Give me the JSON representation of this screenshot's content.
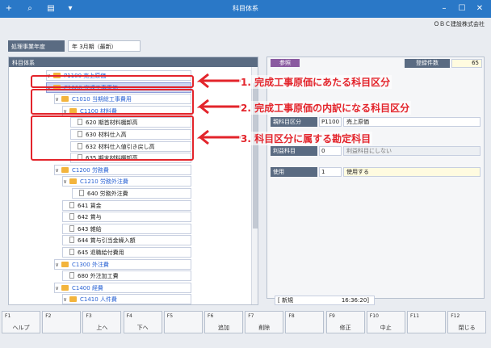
{
  "window": {
    "title": "科目体系"
  },
  "company": "ＯＢＣ建設株式会社",
  "biz_year": {
    "label": "処理事業年度",
    "value": "年 3月期（最新）"
  },
  "left_panel": {
    "title": "科目体系"
  },
  "tree": [
    {
      "code": "P1100",
      "name": "売上原価",
      "type": "folder",
      "blue": true
    },
    {
      "code": "C1000",
      "name": "完成工事原価",
      "type": "folder",
      "blue": true,
      "selected": true
    },
    {
      "code": "C1010",
      "name": "当期総工事費用",
      "type": "folder",
      "blue": true
    },
    {
      "code": "C1100",
      "name": "材料費",
      "type": "folder",
      "blue": true
    },
    {
      "code": "620",
      "name": "期首材料棚卸高",
      "type": "doc"
    },
    {
      "code": "630",
      "name": "材料仕入高",
      "type": "doc"
    },
    {
      "code": "632",
      "name": "材料仕入値引き戻し高",
      "type": "doc"
    },
    {
      "code": "635",
      "name": "期末材料棚卸高",
      "type": "doc"
    },
    {
      "code": "C1200",
      "name": "労務費",
      "type": "folder",
      "blue": true
    },
    {
      "code": "C1210",
      "name": "労務外注費",
      "type": "folder",
      "blue": true
    },
    {
      "code": "640",
      "name": "労務外注費",
      "type": "doc"
    },
    {
      "code": "641",
      "name": "賃金",
      "type": "doc"
    },
    {
      "code": "642",
      "name": "賞与",
      "type": "doc"
    },
    {
      "code": "643",
      "name": "雑給",
      "type": "doc"
    },
    {
      "code": "644",
      "name": "賞与引当金繰入額",
      "type": "doc"
    },
    {
      "code": "645",
      "name": "退職給付費用",
      "type": "doc"
    },
    {
      "code": "C1300",
      "name": "外注費",
      "type": "folder",
      "blue": true
    },
    {
      "code": "680",
      "name": "外注加工費",
      "type": "doc"
    },
    {
      "code": "C1400",
      "name": "経費",
      "type": "folder",
      "blue": true
    },
    {
      "code": "C1410",
      "name": "人件費",
      "type": "folder",
      "blue": true
    }
  ],
  "right_panel": {
    "tab": "参照",
    "count_label": "登録件数",
    "count_value": "65",
    "parent_label": "親科目区分",
    "parent_code": "P1100",
    "parent_name": "売上原価",
    "profit_label": "利益科目",
    "profit_code": "0",
    "profit_name": "利益科目にしない",
    "use_label": "使用",
    "use_code": "1",
    "use_name": "使用する"
  },
  "status": {
    "mode": "[ 新規",
    "time": "16:36:20]"
  },
  "fkeys": [
    {
      "key": "F1",
      "label": "ヘルプ"
    },
    {
      "key": "F2",
      "label": ""
    },
    {
      "key": "F3",
      "label": "上へ"
    },
    {
      "key": "F4",
      "label": "下へ"
    },
    {
      "key": "F5",
      "label": ""
    },
    {
      "key": "F6",
      "label": "追加"
    },
    {
      "key": "F7",
      "label": "削除"
    },
    {
      "key": "F8",
      "label": ""
    },
    {
      "key": "F9",
      "label": "修正"
    },
    {
      "key": "F10",
      "label": "中止"
    },
    {
      "key": "F11",
      "label": ""
    },
    {
      "key": "F12",
      "label": "閉じる"
    }
  ],
  "annotations": [
    "1. 完成工事原価にあたる科目区分",
    "2. 完成工事原価の内訳になる科目区分",
    "3. 科目区分に属する勘定科目"
  ],
  "colors": {
    "titlebar": "#2a78c7",
    "accent": "#e3242b",
    "header": "#5a6b82"
  }
}
